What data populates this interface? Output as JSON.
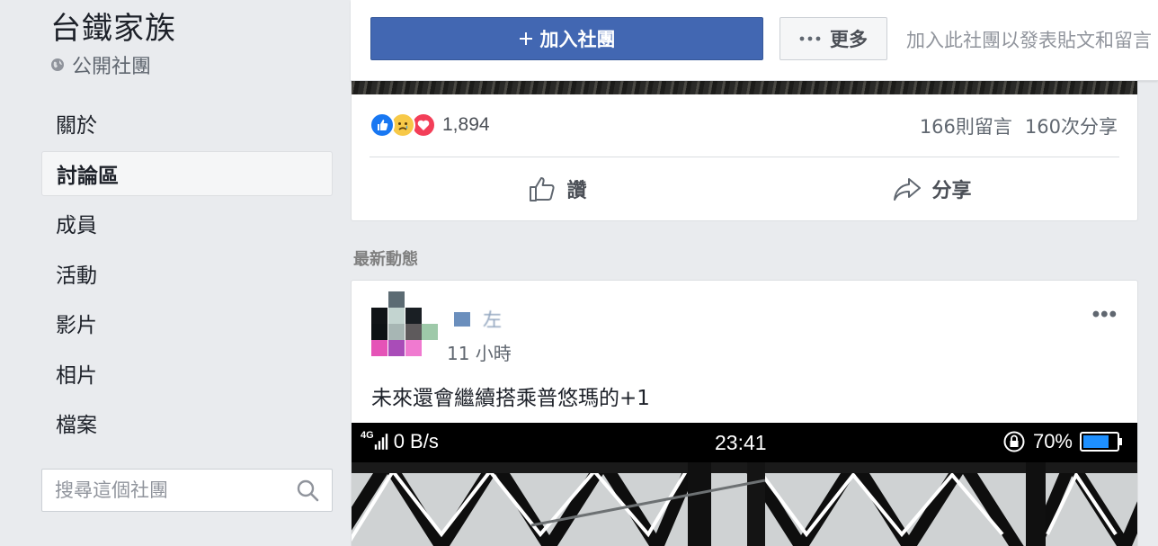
{
  "sidebar": {
    "group_name": "台鐵家族",
    "group_type": "公開社團",
    "nav": [
      {
        "label": "關於",
        "active": false
      },
      {
        "label": "討論區",
        "active": true
      },
      {
        "label": "成員",
        "active": false
      },
      {
        "label": "活動",
        "active": false
      },
      {
        "label": "影片",
        "active": false
      },
      {
        "label": "相片",
        "active": false
      },
      {
        "label": "檔案",
        "active": false
      }
    ],
    "search_placeholder": "搜尋這個社團"
  },
  "topbar": {
    "join_label": "加入社團",
    "join_icon": "plus-icon",
    "more_label": "更多",
    "hint": "加入此社團以發表貼文和留言"
  },
  "post1": {
    "reaction_icons": [
      "like",
      "sad",
      "love"
    ],
    "reaction_count": "1,894",
    "comments": "166則留言",
    "shares": "160次分享",
    "like_label": "讚",
    "share_label": "分享"
  },
  "feed": {
    "section_title": "最新動態"
  },
  "post2": {
    "author_name": "左",
    "time": "11 小時",
    "text": "未來還會繼續搭乘普悠瑪的+1",
    "menu": "•••",
    "status_bar": {
      "network": "4G",
      "speed": "0 B/s",
      "time": "23:41",
      "battery": "70%"
    }
  },
  "colors": {
    "brand_blue": "#4267b2",
    "page_bg": "#e9ebee",
    "like_blue": "#1877f2",
    "love_red": "#f33e58",
    "battery_blue": "#1e90ff"
  }
}
